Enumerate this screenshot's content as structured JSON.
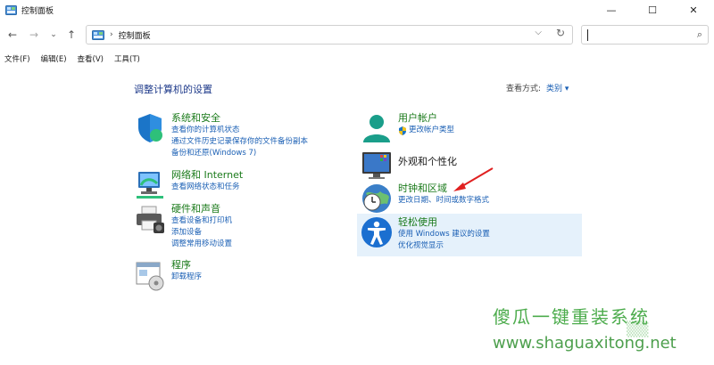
{
  "window": {
    "title": "控制面板",
    "controls": {
      "minimize": "—",
      "maximize": "☐",
      "close": "✕"
    }
  },
  "address": {
    "crumb": "控制面板",
    "separator": "›",
    "dropdown": "⌵",
    "refresh": "↻",
    "search_icon": "⌕"
  },
  "nav": {
    "back": "←",
    "forward": "→",
    "recent": "⌄",
    "up": "↑"
  },
  "menu": [
    "文件(F)",
    "编辑(E)",
    "查看(V)",
    "工具(T)"
  ],
  "page": {
    "title": "调整计算机的设置",
    "view_by_label": "查看方式:",
    "view_by_value": "类别 ▾"
  },
  "categories_left": [
    {
      "title": "系统和安全",
      "icon": "shield-icon",
      "links": [
        "查看你的计算机状态",
        "通过文件历史记录保存你的文件备份副本",
        "备份和还原(Windows 7)"
      ]
    },
    {
      "title": "网络和 Internet",
      "icon": "network-icon",
      "links": [
        "查看网络状态和任务"
      ]
    },
    {
      "title": "硬件和声音",
      "icon": "printer-icon",
      "links": [
        "查看设备和打印机",
        "添加设备",
        "调整常用移动设置"
      ]
    },
    {
      "title": "程序",
      "icon": "programs-icon",
      "links": [
        "卸载程序"
      ]
    }
  ],
  "categories_right": [
    {
      "title": "用户帐户",
      "icon": "user-icon",
      "links": [
        "更改帐户类型"
      ]
    },
    {
      "title": "外观和个性化",
      "icon": "appearance-icon",
      "links": []
    },
    {
      "title": "时钟和区域",
      "icon": "clock-icon",
      "links": [
        "更改日期、时间或数字格式"
      ]
    },
    {
      "title": "轻松使用",
      "icon": "accessibility-icon",
      "links": [
        "使用 Windows 建议的设置",
        "优化视觉显示"
      ]
    }
  ],
  "watermark": {
    "line1": "傻瓜一键重装系统",
    "line2": "www.shaguaxitong.net"
  },
  "colors": {
    "category_title": "#1a7a1a",
    "link": "#1a5fb4",
    "page_title": "#1e3a8a",
    "hover_bg": "#e5f1fb",
    "arrow": "#e02020"
  }
}
